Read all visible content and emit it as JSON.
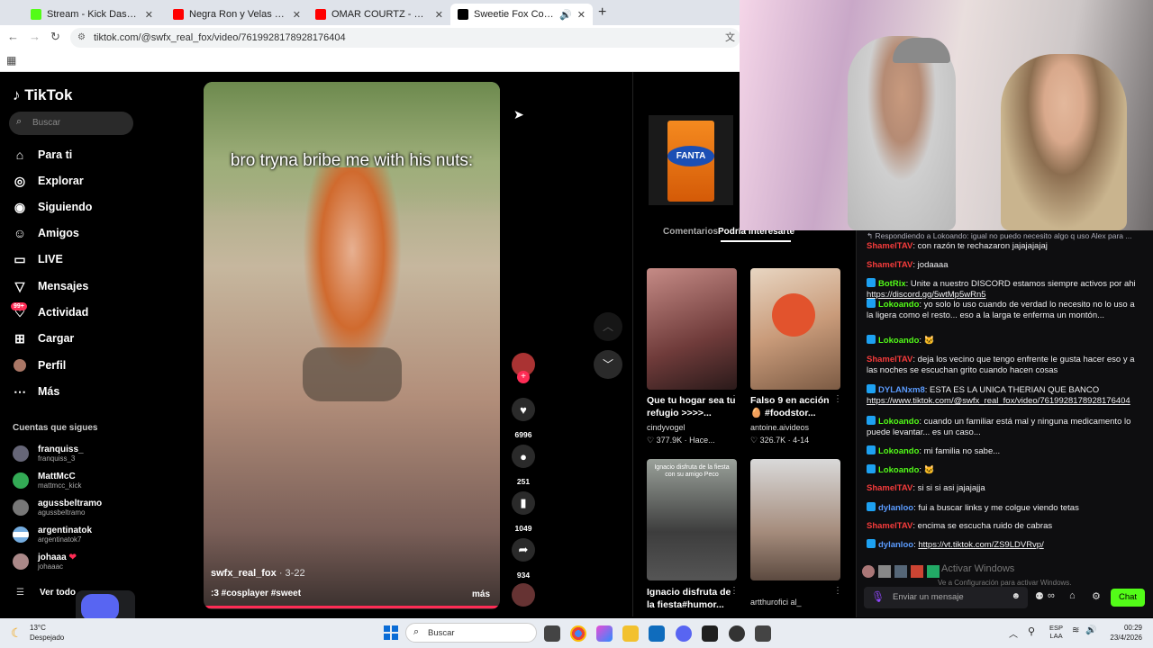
{
  "browser": {
    "tabs": [
      {
        "title": "Stream - Kick Dashboard",
        "color": "#53fc18"
      },
      {
        "title": "Negra Ron y Velas - YouTube",
        "color": "#ff0000"
      },
      {
        "title": "OMAR COURTZ - ESO ES UN V",
        "color": "#ff0000"
      },
      {
        "title": "Sweetie Fox Cosplay - A Sw",
        "color": "#000000"
      }
    ],
    "new_tab": "+",
    "url": "tiktok.com/@swfx_real_fox/video/7619928178928176404"
  },
  "tiktok": {
    "logo": "TikTok",
    "search_placeholder": "Buscar",
    "nav": [
      {
        "label": "Para ti",
        "icon": "home-icon"
      },
      {
        "label": "Explorar",
        "icon": "compass-icon"
      },
      {
        "label": "Siguiendo",
        "icon": "following-icon"
      },
      {
        "label": "Amigos",
        "icon": "friends-icon"
      },
      {
        "label": "LIVE",
        "icon": "live-icon"
      },
      {
        "label": "Mensajes",
        "icon": "messages-icon"
      },
      {
        "label": "Actividad",
        "icon": "activity-icon"
      },
      {
        "label": "Cargar",
        "icon": "upload-icon"
      },
      {
        "label": "Perfil",
        "icon": "profile-icon"
      },
      {
        "label": "Más",
        "icon": "more-icon"
      }
    ],
    "activity_badge": "99+",
    "following_header": "Cuentas que sigues",
    "following": [
      {
        "name": "franquiss_",
        "handle": "franquiss_3"
      },
      {
        "name": "MattMcC",
        "handle": "mattmcc_kick"
      },
      {
        "name": "agussbeltramo",
        "handle": "agussbeltramo"
      },
      {
        "name": "argentinatok",
        "handle": "argentinatok7"
      },
      {
        "name": "johaaa",
        "handle": "johaaac"
      }
    ],
    "see_all": "Ver todo",
    "video": {
      "caption": "bro tryna bribe me with his nuts:",
      "author": "swfx_real_fox",
      "date": "· 3-22",
      "tags": ":3 #cosplayer #sweet",
      "more": "más"
    },
    "actions": {
      "likes": "6996",
      "comments": "251",
      "saves": "1049",
      "shares": "934"
    },
    "tabs": {
      "comments": "Comentarios",
      "might_like": "Podría interesarte"
    },
    "ad_brand": "FANTA",
    "cards": [
      {
        "title": "Que tu hogar sea tu refugio >>>>...",
        "author": "cindyvogel",
        "stats": "377.9K · Hace..."
      },
      {
        "title": "Falso 9 en acción 🥚 #foodstor...",
        "author": "antoine.aivideos",
        "stats": "326.7K · 4-14"
      },
      {
        "title": "Ignacio disfruta de la fiesta#humor...",
        "author": "",
        "stats": ""
      },
      {
        "title": "",
        "author": "artthurofici al_",
        "stats": ""
      }
    ],
    "card3_overlay": "Ignacio disfruta de la fiesta con su amigo Peco"
  },
  "chat": {
    "reply_to": "Respondiendo a Lokoando: igual no puedo necesito algo q uso Alex para ...",
    "messages": [
      {
        "user": "ShamelTAV",
        "cls": "u1",
        "badge": "",
        "text": ": con razón te rechazaron jajajajajaj"
      },
      {
        "user": "ShamelTAV",
        "cls": "u1",
        "badge": "",
        "text": ": jodaaaa"
      },
      {
        "user": "BotRix",
        "cls": "u2",
        "badge": "b",
        "text": ": Unite a nuestro DISCORD estamos siempre activos por ahi ",
        "link": "https://discord.gg/5wtMp5wRn5"
      },
      {
        "user": "Lokoando",
        "cls": "u2",
        "badge": "b",
        "text": ": yo solo lo uso cuando de verdad lo necesito no lo uso a la ligera como el resto... eso a la larga te enferma un montón..."
      },
      {
        "user": "Lokoando",
        "cls": "u2",
        "badge": "b",
        "text": ": 🐱"
      },
      {
        "user": "ShamelTAV",
        "cls": "u1",
        "badge": "",
        "text": ": deja los vecino que tengo enfrente le gusta hacer eso y a las noches se escuchan grito cuando hacen cosas"
      },
      {
        "user": "DYLANxm8",
        "cls": "u3",
        "badge": "b",
        "text": ": ESTA ES LA UNICA THERIAN QUE BANCO ",
        "link": "https://www.tiktok.com/@swfx_real_fox/video/7619928178928176404"
      },
      {
        "user": "Lokoando",
        "cls": "u2",
        "badge": "b",
        "text": ": cuando un familiar está mal y ninguna medicamento lo puede levantar... es un caso..."
      },
      {
        "user": "Lokoando",
        "cls": "u2",
        "badge": "b",
        "text": ": mi familia no sabe..."
      },
      {
        "user": "Lokoando",
        "cls": "u2",
        "badge": "b",
        "text": ": 🐱"
      },
      {
        "user": "ShamelTAV",
        "cls": "u1",
        "badge": "",
        "text": ": si si si asi jajajajja"
      },
      {
        "user": "dylanloo",
        "cls": "u3",
        "badge": "b",
        "text": ": fui a buscar links y me colgue viendo tetas"
      },
      {
        "user": "ShamelTAV",
        "cls": "u1",
        "badge": "",
        "text": ": encima se escucha ruido de cabras"
      },
      {
        "user": "dylanloo",
        "cls": "u3",
        "badge": "b",
        "text": ": ",
        "link": "https://vt.tiktok.com/ZS9LDVRvp/"
      }
    ],
    "activate_windows": "Activar Windows",
    "activate_windows_sub": "Ve a Configuración para activar Windows.",
    "input_placeholder": "Enviar un mensaje",
    "chat_button": "Chat"
  },
  "taskbar": {
    "weather_temp": "13°C",
    "weather_desc": "Despejado",
    "search": "Buscar",
    "lang1": "ESP",
    "lang2": "LAA",
    "time": "00:29",
    "date": "23/4/2026"
  }
}
